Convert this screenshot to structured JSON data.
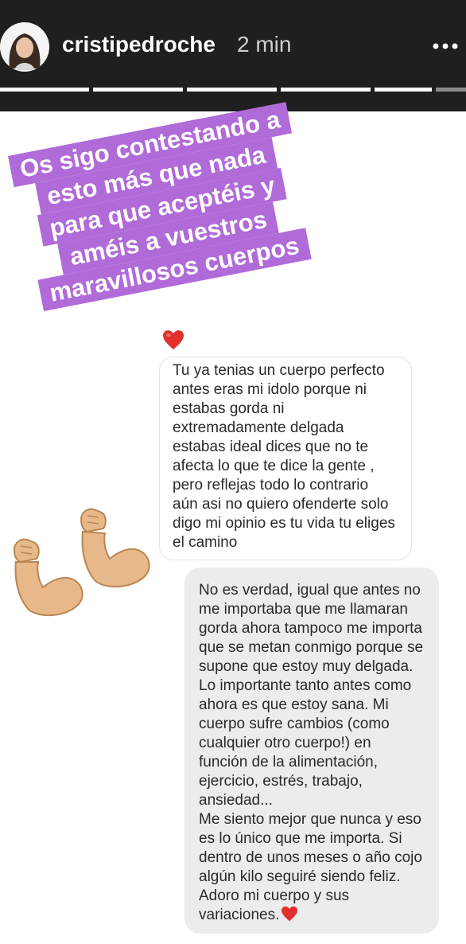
{
  "header": {
    "username": "cristipedroche",
    "time": "2 min",
    "more_icon": "ellipsis-icon",
    "avatar_icon": "profile-avatar",
    "progress_segments": [
      1,
      1,
      1,
      1,
      1,
      0
    ]
  },
  "sticker": {
    "lines": [
      "Os sigo contestando a",
      "esto más que nada",
      "para que aceptéis y",
      "améis a vuestros",
      "maravillosos cuerpos"
    ],
    "color": "#b06bd8"
  },
  "incoming_message": {
    "lines": [
      "Tu ya tenias un cuerpo perfecto",
      "antes eras mi idolo porque ni",
      "estabas gorda ni",
      "extremadamente delgada",
      "estabas ideal dices que no te",
      "afecta lo que te dice la gente ,",
      "pero  reflejas todo lo contrario",
      "aún asi no quiero ofenderte solo",
      "digo mi opinio es tu vida tu eliges",
      "el camino"
    ]
  },
  "outgoing_message": {
    "lines": [
      "No es verdad, igual que antes no",
      "me importaba que me llamaran",
      "gorda ahora tampoco me importa",
      "que se metan conmigo porque se",
      "supone que estoy muy delgada.",
      "Lo importante tanto antes como",
      "ahora es que estoy sana. Mi",
      "cuerpo sufre cambios (como",
      "cualquier otro cuerpo!) en",
      "función de la alimentación,",
      "ejercicio, estrés, trabajo,",
      "ansiedad...",
      "Me siento mejor que nunca y eso",
      "es lo único que me importa. Si",
      "dentro de unos meses o año cojo",
      "algún kilo seguiré siendo feliz.",
      "Adoro mi cuerpo y sus",
      "variaciones."
    ]
  },
  "icons": {
    "heart": "red-heart-icon",
    "arms": "flexed-biceps-icon"
  }
}
